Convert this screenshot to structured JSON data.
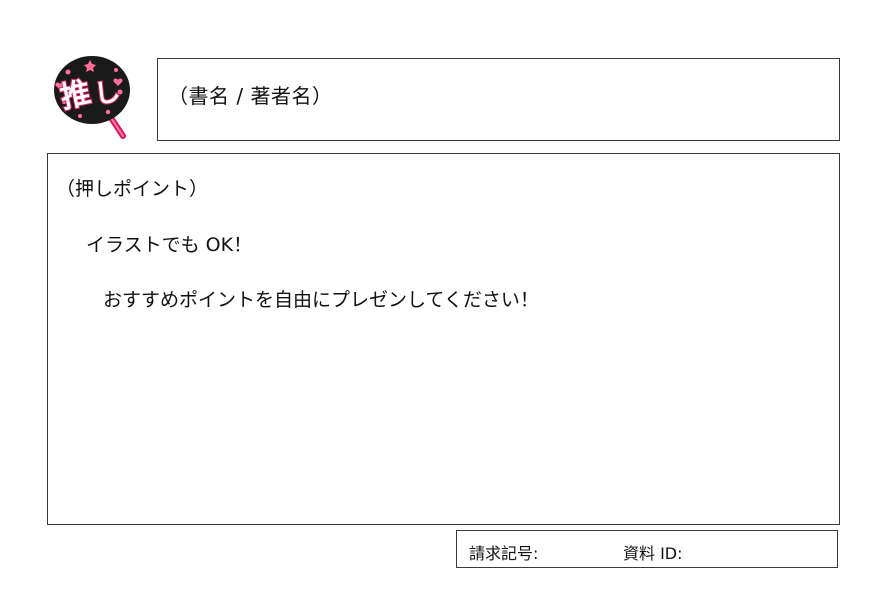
{
  "logo": {
    "text": "推し",
    "icon": "oshi-uchiwa-fan-icon",
    "colors": {
      "fan": "#1a1a1a",
      "text": "#ffffff",
      "text_outline": "#e0245e",
      "accent": "#ff6f9a",
      "handle": "#d81b5a"
    }
  },
  "title_box": {
    "text": "（書名 / 著者名）"
  },
  "main_box": {
    "heading": "（押しポイント）",
    "line1": "イラストでも OK！",
    "line2": "おすすめポイントを自由にプレゼンしてください！"
  },
  "footer": {
    "request_label": "請求記号:",
    "material_label": "資料 ID:"
  }
}
